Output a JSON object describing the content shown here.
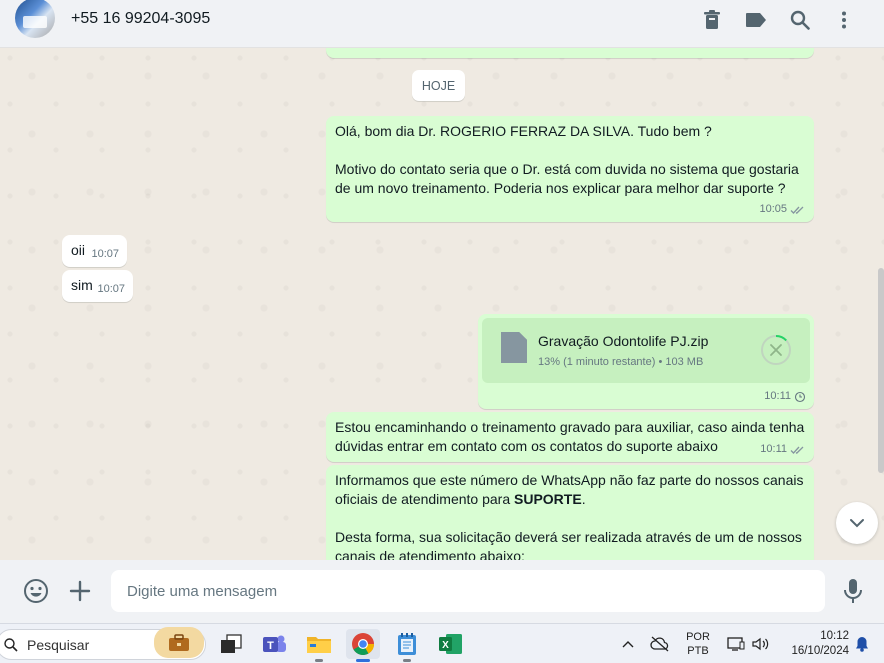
{
  "header": {
    "contact": "+55 16 99204-3095",
    "icons": [
      "trash-icon",
      "label-icon",
      "search-icon",
      "menu-dots-icon"
    ]
  },
  "chat": {
    "date_chip": "HOJE",
    "messages": [
      {
        "direction": "out",
        "lines": [
          "Olá, bom dia Dr. ROGERIO FERRAZ DA SILVA. Tudo bem ?",
          "",
          "Motivo do contato seria que o Dr. está com duvida no sistema que gostaria de um novo treinamento. Poderia nos explicar para melhor dar suporte ?"
        ],
        "time": "10:05",
        "status": "double-check"
      },
      {
        "direction": "in",
        "text": "oii",
        "time": "10:07"
      },
      {
        "direction": "in",
        "text": "sim",
        "time": "10:07"
      },
      {
        "direction": "out",
        "file": {
          "name": "Gravação Odontolife PJ.zip",
          "progress_label": "13% (1 minuto restante)",
          "size": "103 MB",
          "progress": 0.13
        },
        "time": "10:11",
        "status": "clock-pending"
      },
      {
        "direction": "out",
        "text": "Estou encaminhando o treinamento gravado para auxiliar, caso ainda tenha dúvidas entrar em contato com os contatos do suporte abaixo",
        "time": "10:11",
        "status": "double-check"
      },
      {
        "direction": "out",
        "p1_before": "Informamos que este número de WhatsApp não faz parte do nossos canais oficiais de atendimento para ",
        "p1_bold": "SUPORTE",
        "p1_after": ".",
        "p2": "Desta forma, sua solicitação deverá ser realizada através de um de nossos canais de atendimento abaixo:"
      }
    ]
  },
  "composer": {
    "placeholder": "Digite uma mensagem"
  },
  "taskbar": {
    "search_label": "Pesquisar",
    "apps": [
      "briefcase-icon",
      "task-view-icon",
      "teams-icon",
      "file-explorer-icon",
      "chrome-icon",
      "notepad-icon",
      "excel-icon"
    ],
    "lang_top": "POR",
    "lang_bottom": "PTB",
    "time": "10:12",
    "date": "16/10/2024"
  },
  "colors": {
    "outgoing_bubble": "#d9fdd3",
    "incoming_bubble": "#ffffff",
    "chat_background": "#efeae2",
    "read_ticks": "#8696a0"
  }
}
